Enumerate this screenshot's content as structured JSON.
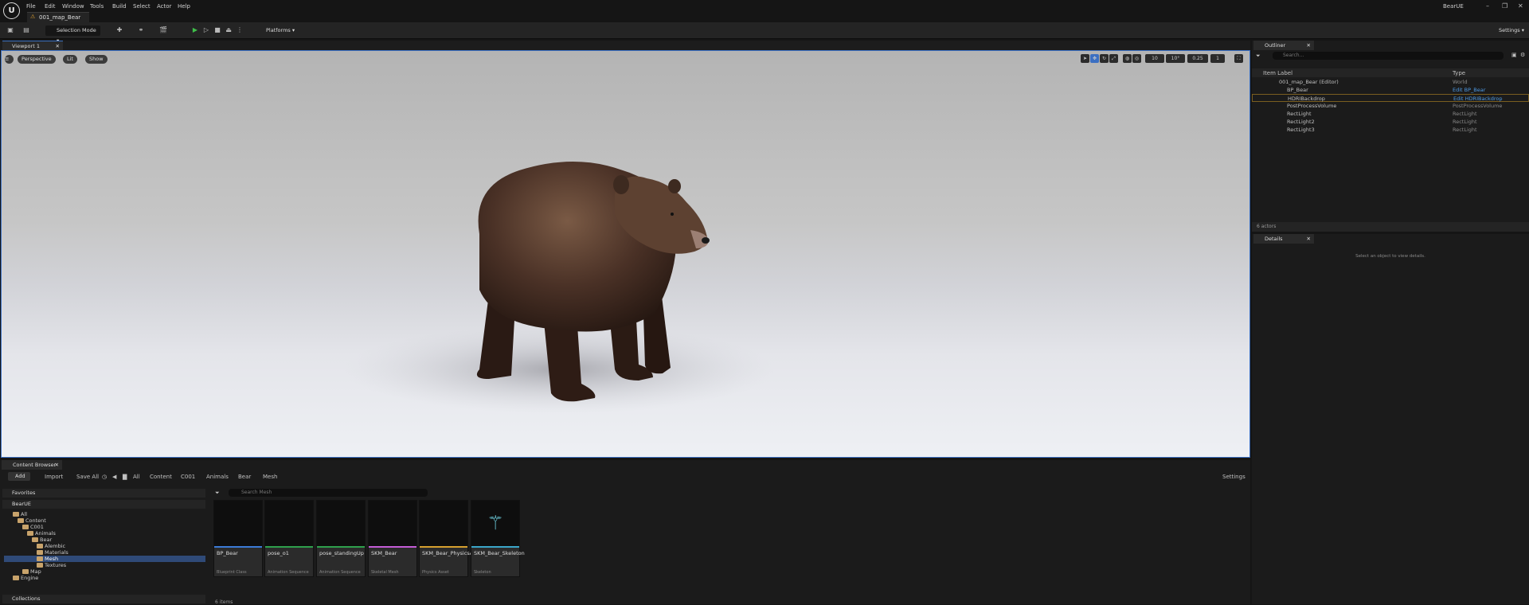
{
  "menu": [
    "File",
    "Edit",
    "Window",
    "Tools",
    "Build",
    "Select",
    "Actor",
    "Help"
  ],
  "map_tab": "001_map_Bear",
  "app_name": "BearUE",
  "toolbar": {
    "selection_mode": "Selection Mode",
    "platforms": "Platforms",
    "settings": "Settings"
  },
  "viewport": {
    "tab": "Viewport 1",
    "perspective": "Perspective",
    "lit": "Lit",
    "show": "Show",
    "grid_snap": "10",
    "rot_snap": "10°",
    "scale_snap": "0.25",
    "camera_speed": "1"
  },
  "outliner": {
    "tab": "Outliner",
    "search_placeholder": "Search...",
    "col_label": "Item Label",
    "col_type": "Type",
    "footer": "6 actors",
    "rows": [
      {
        "label": "001_map_Bear (Editor)",
        "type": "World"
      },
      {
        "label": "BP_Bear",
        "type": "Edit BP_Bear"
      },
      {
        "label": "HDRIBackdrop",
        "type": "Edit HDRIBackdrop"
      },
      {
        "label": "PostProcessVolume",
        "type": "PostProcessVolume"
      },
      {
        "label": "RectLight",
        "type": "RectLight"
      },
      {
        "label": "RectLight2",
        "type": "RectLight"
      },
      {
        "label": "RectLight3",
        "type": "RectLight"
      }
    ]
  },
  "details": {
    "tab": "Details",
    "empty": "Select an object to view details."
  },
  "content_browser": {
    "tab": "Content Browser",
    "add": "Add",
    "import": "Import",
    "save_all": "Save All",
    "settings": "Settings",
    "breadcrumb": [
      "All",
      "Content",
      "C001",
      "Animals",
      "Bear",
      "Mesh"
    ],
    "search_placeholder": "Search Mesh",
    "favorites": "Favorites",
    "project": "BearUE",
    "collections": "Collections",
    "item_count": "6 items",
    "tree": [
      "All",
      "Content",
      "C001",
      "Animals",
      "Bear",
      "Alembic",
      "Materials",
      "Mesh",
      "Textures",
      "Map",
      "Engine"
    ],
    "assets": [
      {
        "name": "BP_Bear",
        "type": "Blueprint Class",
        "color": "#3b7bd6"
      },
      {
        "name": "pose_o1",
        "type": "Animation Sequence",
        "color": "#2fa04c"
      },
      {
        "name": "pose_standingUp",
        "type": "Animation Sequence",
        "color": "#2fa04c"
      },
      {
        "name": "SKM_Bear",
        "type": "Skeletal Mesh",
        "color": "#c45cd6"
      },
      {
        "name": "SKM_Bear_PhysicsAsset",
        "type": "Physics Asset",
        "color": "#d6a02f"
      },
      {
        "name": "SKM_Bear_Skeleton",
        "type": "Skeleton",
        "color": "#3aa6c9"
      }
    ]
  }
}
